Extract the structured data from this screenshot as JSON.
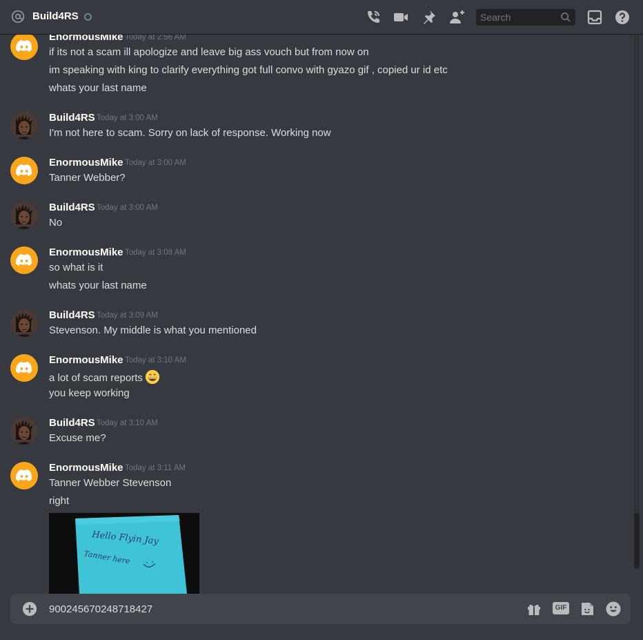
{
  "header": {
    "channel_title": "Build4RS",
    "search": {
      "placeholder": "Search"
    }
  },
  "icons": {
    "at": "at-sign-icon",
    "call": "phone-call-icon",
    "video": "video-call-icon",
    "pin": "pin-icon",
    "add_friend": "add-friend-icon",
    "search": "search-icon",
    "inbox": "inbox-icon",
    "help": "help-icon",
    "attach": "add-attachment-icon",
    "gift": "gift-icon",
    "gif": "gif-icon",
    "sticker": "sticker-icon",
    "emoji": "emoji-icon"
  },
  "colors": {
    "background": "#36393f",
    "header_border": "#202225",
    "discord_avatar": "#faa61a",
    "username": "#ffffff",
    "timestamp": "#72767d",
    "message_text": "#dcddde",
    "composer": "#40444b"
  },
  "messages": [
    {
      "author": "EnormousMike",
      "avatar": "discord-logo-avatar",
      "timestamp": "Today at 2:56 AM",
      "lines": [
        "if its not a scam ill apologize and leave big ass vouch but from now on",
        "im speaking with king to clarify everything got full convo with gyazo gif , copied ur id etc",
        "whats your last name"
      ]
    },
    {
      "author": "Build4RS",
      "avatar": "user-photo-avatar",
      "timestamp": "Today at 3:00 AM",
      "lines": [
        "I'm not here to scam. Sorry on lack of response. Working now"
      ]
    },
    {
      "author": "EnormousMike",
      "avatar": "discord-logo-avatar",
      "timestamp": "Today at 3:00 AM",
      "lines": [
        "Tanner Webber?"
      ]
    },
    {
      "author": "Build4RS",
      "avatar": "user-photo-avatar",
      "timestamp": "Today at 3:00 AM",
      "lines": [
        "No"
      ]
    },
    {
      "author": "EnormousMike",
      "avatar": "discord-logo-avatar",
      "timestamp": "Today at 3:08 AM",
      "lines": [
        "so what is it",
        "whats your last name"
      ]
    },
    {
      "author": "Build4RS",
      "avatar": "user-photo-avatar",
      "timestamp": "Today at 3:09 AM",
      "lines": [
        "Stevenson. My middle is what you mentioned"
      ]
    },
    {
      "author": "EnormousMike",
      "avatar": "discord-logo-avatar",
      "timestamp": "Today at 3:10 AM",
      "lines": [
        "a lot of scam reports",
        "you keep working"
      ],
      "emoji": "grinning-face-emoji"
    },
    {
      "author": "Build4RS",
      "avatar": "user-photo-avatar",
      "timestamp": "Today at 3:10 AM",
      "lines": [
        "Excuse me?"
      ]
    },
    {
      "author": "EnormousMike",
      "avatar": "discord-logo-avatar",
      "timestamp": "Today at 3:11 AM",
      "lines": [
        "Tanner Webber Stevenson",
        "right"
      ],
      "attachment": {
        "kind": "photo-of-handwritten-note",
        "handwriting_line1": "Hello Flyin Jay",
        "handwriting_line2": "Tanner here"
      }
    }
  ],
  "composer": {
    "value": "900245670248718427",
    "gif_label": "GIF"
  }
}
